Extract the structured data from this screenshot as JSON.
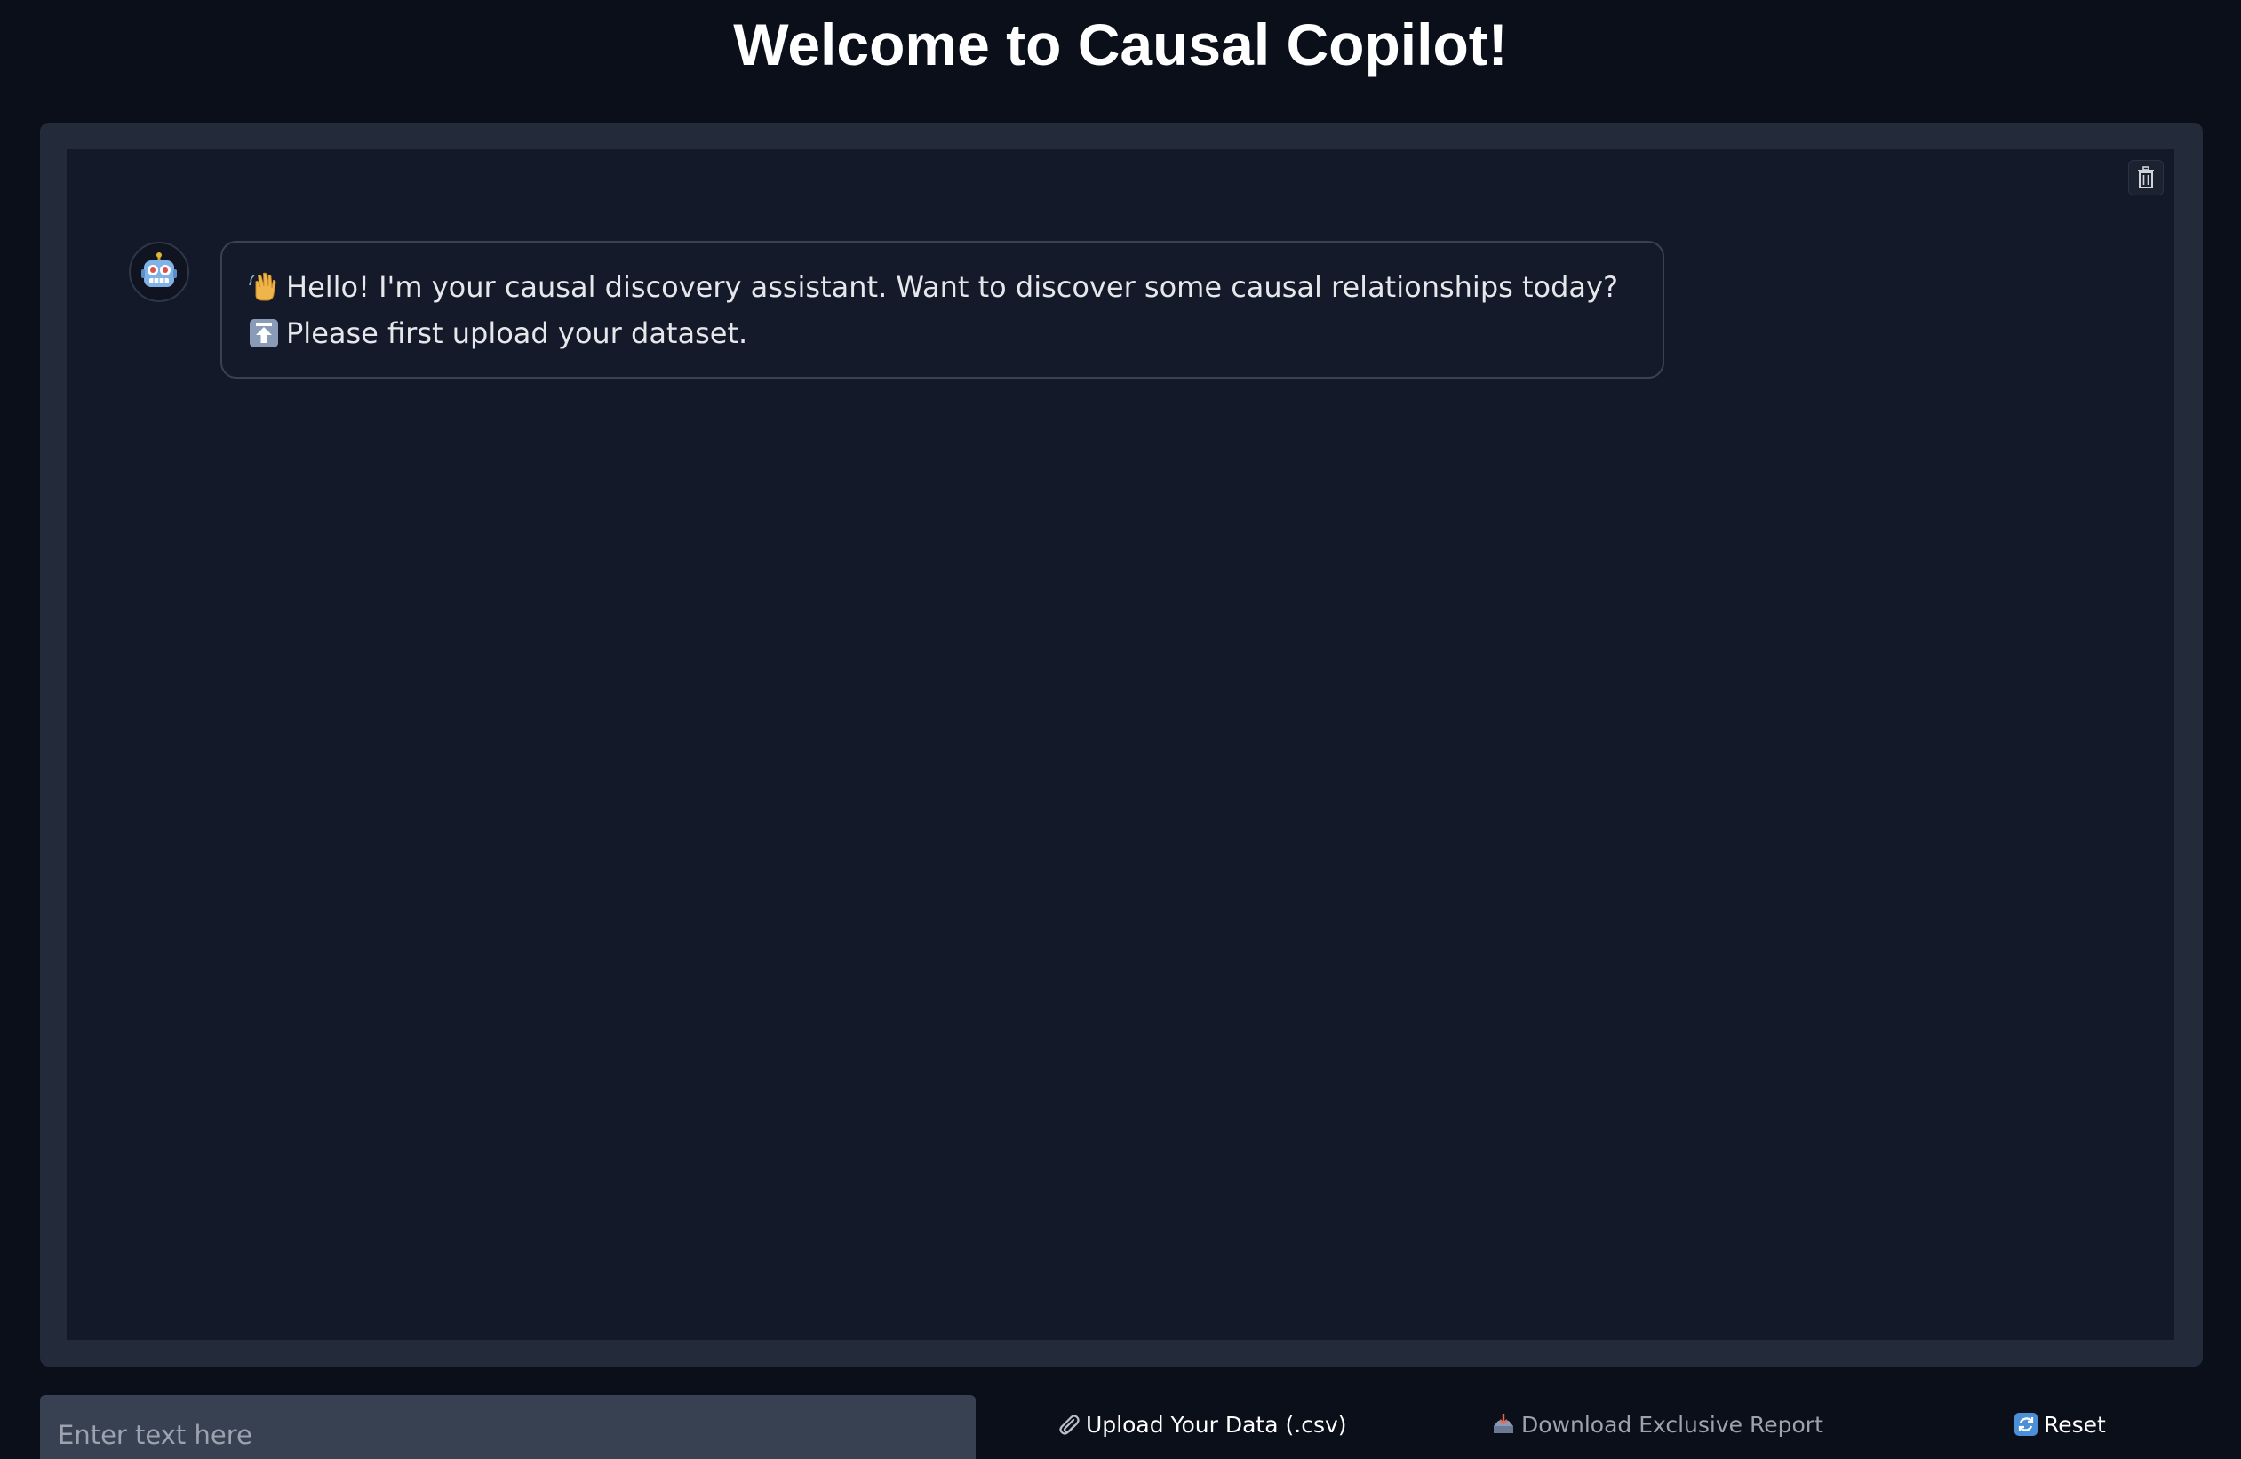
{
  "header": {
    "title": "Welcome to Causal Copilot!"
  },
  "chat": {
    "clear_icon": "trash-icon",
    "avatar_icon": "robot-icon",
    "messages": [
      {
        "role": "assistant",
        "lines": [
          {
            "icon": "waving-hand-icon",
            "text": "Hello! I'm your causal discovery assistant. Want to discover some causal relationships today?"
          },
          {
            "icon": "up-arrow-icon",
            "text": "Please first upload your dataset."
          }
        ]
      }
    ]
  },
  "input": {
    "placeholder": "Enter text here",
    "value": ""
  },
  "actions": {
    "upload": {
      "icon": "paperclip-icon",
      "label": "Upload Your Data (.csv)"
    },
    "download": {
      "icon": "inbox-tray-icon",
      "label": "Download Exclusive Report",
      "disabled": true
    },
    "reset": {
      "icon": "refresh-icon",
      "label": "Reset"
    }
  },
  "colors": {
    "background": "#0b0f19",
    "panel": "#232a39",
    "chat_area": "#131928",
    "input_bg": "#374151",
    "text": "#e5e7eb",
    "muted": "#9ca3af"
  }
}
